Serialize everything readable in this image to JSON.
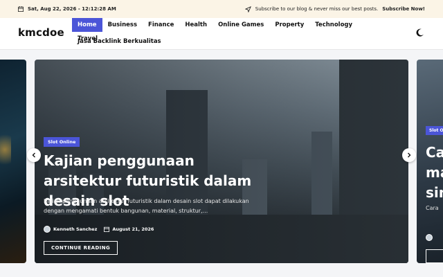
{
  "topbar": {
    "date": "Sat, Aug 22, 2026 - 12:12:28 AM",
    "promo_text": "Subscribe to our blog & never miss our best posts.",
    "promo_link": "Subscribe Now!"
  },
  "header": {
    "logo": "kmcdoe",
    "nav": [
      {
        "label": "Home",
        "active": true
      },
      {
        "label": "Business"
      },
      {
        "label": "Finance"
      },
      {
        "label": "Health"
      },
      {
        "label": "Online Games"
      },
      {
        "label": "Property"
      },
      {
        "label": "Technology"
      },
      {
        "label": "Travel"
      }
    ],
    "nav_row2": "Jasa Backlink Berkualitas"
  },
  "slider": {
    "main": {
      "category": "Slot Online",
      "title": "Kajian penggunaan arsitektur futuristik dalam desain slot",
      "excerpt": "Kajian penggunaan arsitektur futuristik dalam desain slot dapat dilakukan dengan mengamati bentuk bangunan, material, struktur,...",
      "author": "Kenneth Sanchez",
      "date": "August 21, 2026",
      "cta": "CONTINUE READING"
    },
    "next": {
      "category": "Slot O",
      "title_lines": [
        "Ca",
        "ma",
        "sin"
      ],
      "excerpt": "Cara"
    }
  },
  "colors": {
    "accent": "#4b55d8",
    "topbar_bg": "#fbf4e6"
  }
}
